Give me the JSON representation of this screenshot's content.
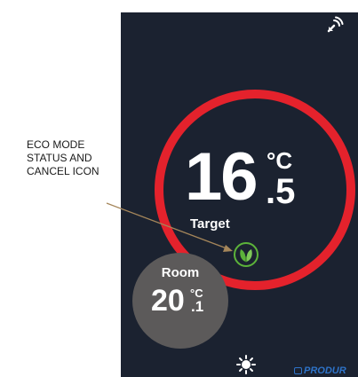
{
  "annotation": {
    "lines": [
      "ECO MODE",
      "STATUS AND",
      "CANCEL ICON"
    ]
  },
  "thermostat": {
    "target_temp_whole": "16",
    "target_temp_decimal": ".5",
    "target_unit": "°C",
    "target_label": "Target",
    "room_label": "Room",
    "room_temp_whole": "20",
    "room_temp_decimal": ".1",
    "room_unit": "°C",
    "ring_color": "#e4222c",
    "eco_icon_color": "#5cb33a",
    "background_color": "#1b2230"
  },
  "brand": {
    "name": "PRODUR"
  },
  "icons": {
    "top_right": "remote-signal-icon",
    "bottom": "brightness-icon",
    "eco": "eco-leaf-icon"
  }
}
